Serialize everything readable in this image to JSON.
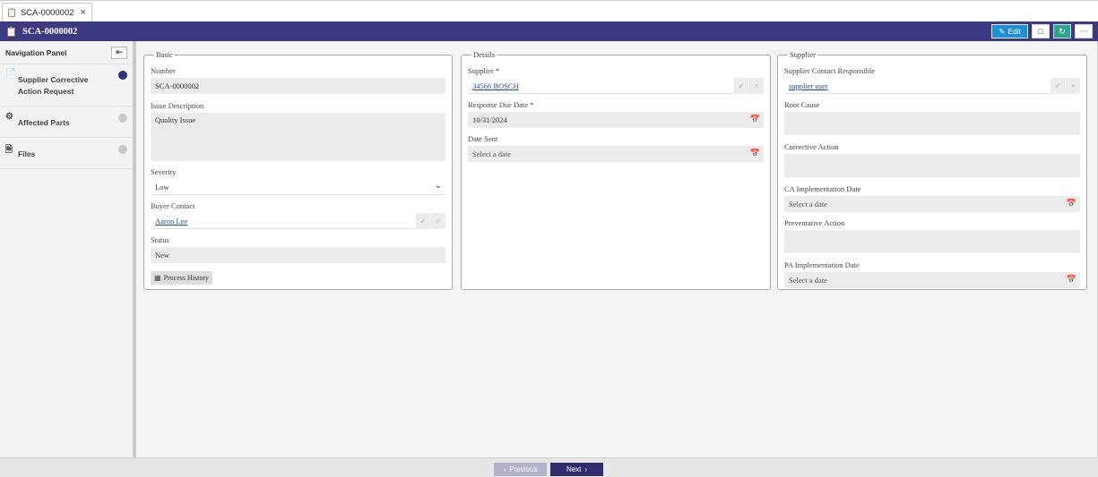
{
  "doc_tab": {
    "label": "SCA-0000002"
  },
  "header": {
    "title": "SCA-0000002",
    "edit_label": "Edit",
    "more_label": "···"
  },
  "nav": {
    "title": "Navigation Panel",
    "items": [
      {
        "label": "Supplier Corrective Action Request",
        "active": true
      },
      {
        "label": "Affected Parts",
        "active": false
      },
      {
        "label": "Files",
        "active": false
      }
    ]
  },
  "basic": {
    "legend": "Basic",
    "number_label": "Number",
    "number_value": "SCA-0000002",
    "issue_label": "Issue Description",
    "issue_value": "Quality Issue",
    "severity_label": "Severity",
    "severity_value": "Low",
    "buyer_label": "Buyer Contact",
    "buyer_value": "Aaron Lee",
    "status_label": "Status",
    "status_value": "New",
    "process_history_label": "Process History"
  },
  "details": {
    "legend": "Details",
    "supplier_label": "Supplier *",
    "supplier_value": "34566 BOSCH",
    "due_label": "Response Due Date *",
    "due_value": "10/31/2024",
    "sent_label": "Date Sent",
    "sent_placeholder": "Select a date"
  },
  "supplier": {
    "legend": "Supplier",
    "contact_label": "Supplier Contact Responsible",
    "contact_value": "supplier user",
    "root_label": "Root Cause",
    "corrective_label": "Corrective Action",
    "ca_date_label": "CA Implementation Date",
    "ca_date_placeholder": "Select a date",
    "preventative_label": "Preventative Action",
    "pa_date_label": "PA Implementation Date",
    "pa_date_placeholder": "Select a date"
  },
  "footer": {
    "previous_label": "Previous",
    "next_label": "Next"
  }
}
